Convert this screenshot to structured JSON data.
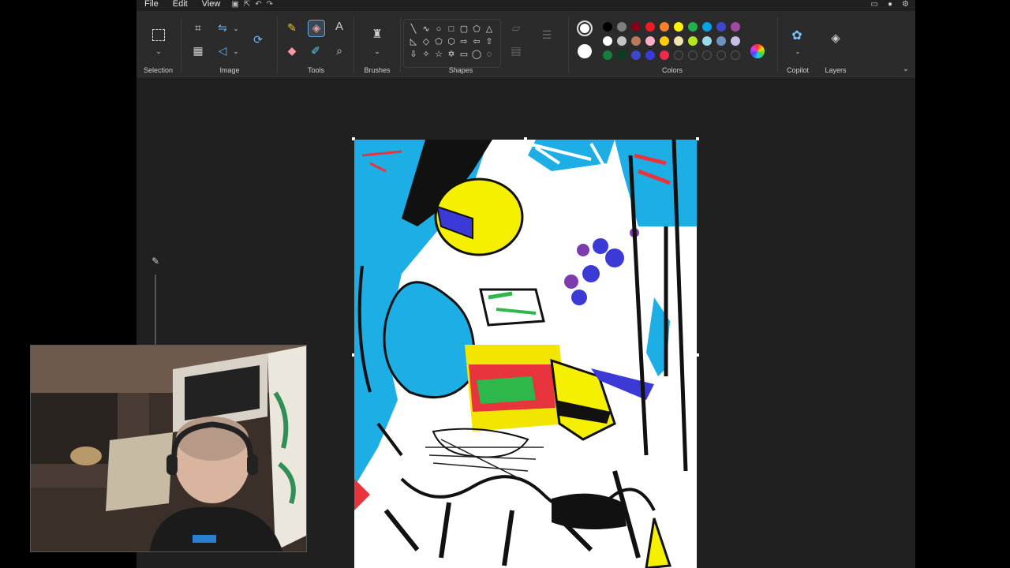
{
  "menu": {
    "file": "File",
    "edit": "Edit",
    "view": "View"
  },
  "ribbon": {
    "selection_label": "Selection",
    "image_label": "Image",
    "tools_label": "Tools",
    "brushes_label": "Brushes",
    "shapes_label": "Shapes",
    "colors_label": "Colors",
    "copilot_label": "Copilot",
    "layers_label": "Layers"
  },
  "tools": {
    "text_glyph": "A"
  },
  "colors": {
    "current_primary": "#ffffff",
    "current_secondary": "#ffffff",
    "palette_row1": [
      "#000000",
      "#7f7f7f",
      "#880015",
      "#ed1c24",
      "#ff7f27",
      "#fff200",
      "#22b14c",
      "#00a2e8",
      "#3f48cc",
      "#a349a4"
    ],
    "palette_row2": [
      "#ffffff",
      "#c3c3c3",
      "#b97a57",
      "#ffaec9",
      "#ffc90e",
      "#efe4b0",
      "#b5e61d",
      "#99d9ea",
      "#7092be",
      "#c8bfe7"
    ],
    "palette_row3": [
      "#15803d",
      "#0a3d1f",
      "#3f48cc",
      "#3a3ad8",
      "#ef2b4b",
      "",
      "",
      "",
      "",
      ""
    ]
  },
  "icons": {
    "selection": "selection-rect-icon",
    "crop": "crop-icon",
    "resize": "resize-icon",
    "rotate": "rotate-icon",
    "flip": "flip-icon",
    "image_creator": "image-creator-icon",
    "pencil": "pencil-icon",
    "fill": "fill-bucket-icon",
    "text": "text-icon",
    "eraser": "eraser-icon",
    "color_picker": "color-picker-icon",
    "magnifier": "magnifier-icon",
    "brush": "brush-icon",
    "outline": "shape-outline-icon",
    "shape_fill": "shape-fill-icon",
    "edit_colors": "edit-colors-icon",
    "copilot": "copilot-icon",
    "layers": "layers-icon",
    "expand": "chevron-down-icon"
  }
}
